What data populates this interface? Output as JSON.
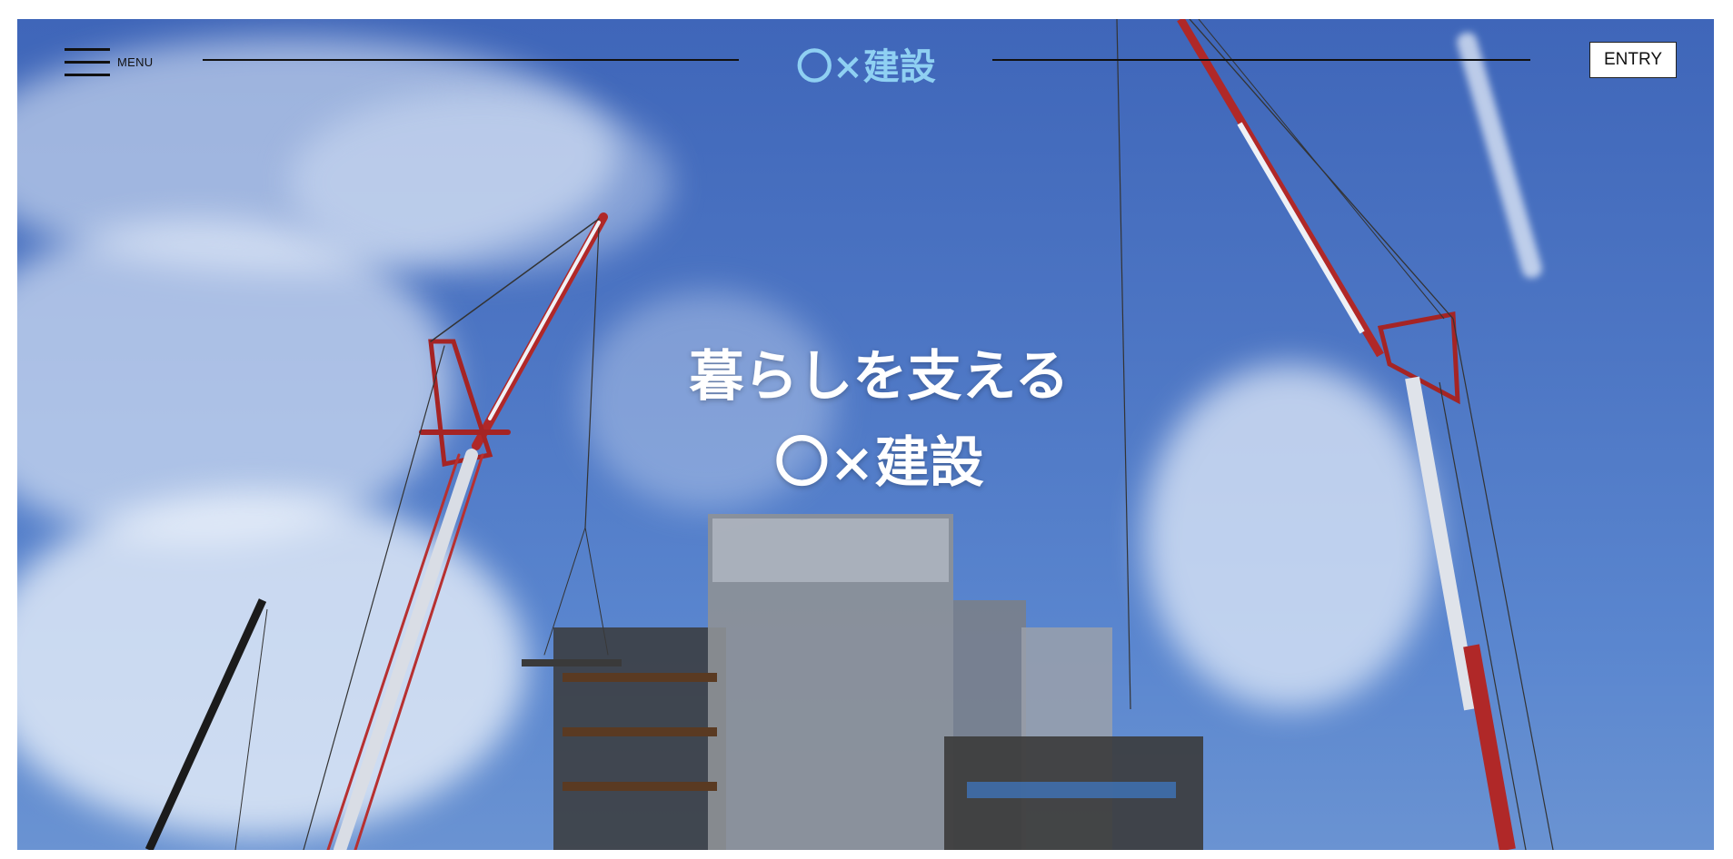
{
  "header": {
    "menu_label": "MENU",
    "logo_text": "〇×建設",
    "entry_label": "ENTRY"
  },
  "hero": {
    "catch_line1": "暮らしを支える",
    "catch_line2": "〇×建設"
  },
  "colors": {
    "logo": "#8fd0f2",
    "sky": "#4d76c4",
    "crane_red": "#a52a2a",
    "crane_white": "#e9eef5"
  },
  "icons": [
    "hamburger-menu-icon"
  ]
}
